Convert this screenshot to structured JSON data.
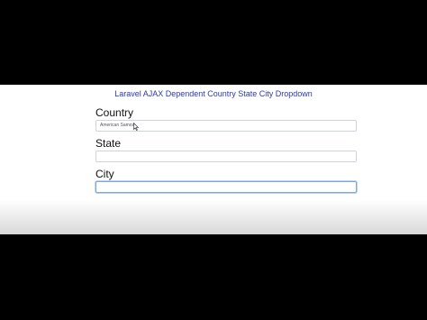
{
  "page": {
    "title": "Laravel AJAX Dependent Country State City Dropdown"
  },
  "form": {
    "country": {
      "label": "Country",
      "value": "American Samoa"
    },
    "state": {
      "label": "State",
      "value": ""
    },
    "city": {
      "label": "City",
      "value": ""
    }
  },
  "colors": {
    "title": "#2d3aa8",
    "focus_border": "#7fa8d8",
    "letterbox": "#000000"
  },
  "icons": {
    "cursor": "mouse-pointer-icon"
  }
}
